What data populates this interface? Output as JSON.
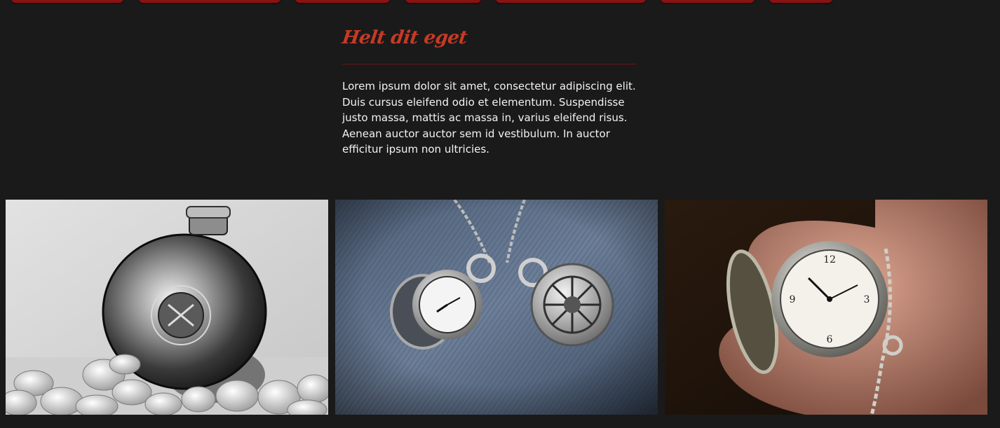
{
  "nav": {
    "items": [
      "",
      "",
      "",
      "",
      "",
      "",
      ""
    ],
    "accent": "#8a1212"
  },
  "section": {
    "title": "Helt dit eget",
    "title_color": "#c63a25",
    "body": "Lorem ipsum dolor sit amet, consectetur adipiscing elit. Duis cursus eleifend odio et elementum. Suspendisse justo massa, mattis ac massa in, varius eleifend risus. Aenean auctor auctor sem id vestibulum. In auctor efficitur ipsum non ultricies."
  },
  "gallery": {
    "images": [
      {
        "subject": "silver hip flask on white pebbles",
        "alt": ""
      },
      {
        "subject": "two pocket watch pendants on denim",
        "alt": ""
      },
      {
        "subject": "open pocket watch held in hand",
        "alt": ""
      }
    ]
  },
  "colors": {
    "background": "#1a1a1a",
    "text": "#f3f3f3",
    "divider": "#6b1414"
  }
}
